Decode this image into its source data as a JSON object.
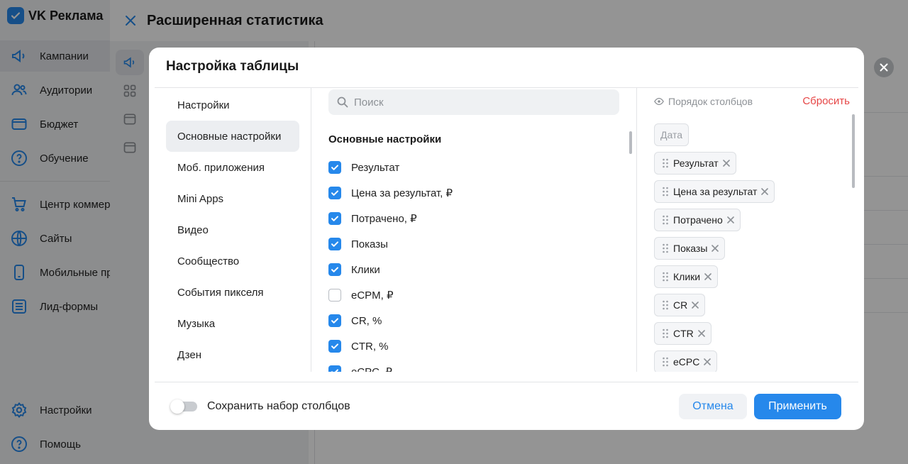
{
  "app": {
    "logo_text": "VK Реклама"
  },
  "sidebar": {
    "items": [
      {
        "label": "Кампании",
        "icon": "megaphone-icon",
        "active": true
      },
      {
        "label": "Аудитории",
        "icon": "users-icon"
      },
      {
        "label": "Бюджет",
        "icon": "wallet-icon"
      },
      {
        "label": "Обучение",
        "icon": "help-circle-icon"
      },
      {
        "label": "Центр коммер",
        "icon": "cart-icon"
      },
      {
        "label": "Сайты",
        "icon": "globe-icon"
      },
      {
        "label": "Мобильные пр",
        "icon": "phone-icon"
      },
      {
        "label": "Лид-формы",
        "icon": "list-icon"
      },
      {
        "label": "Настройки",
        "icon": "gear-icon"
      },
      {
        "label": "Помощь",
        "icon": "help-circle-icon"
      }
    ]
  },
  "page": {
    "title": "Расширенная статистика"
  },
  "modal": {
    "title": "Настройка таблицы",
    "categories": [
      "Настройки",
      "Основные настройки",
      "Моб. приложения",
      "Mini Apps",
      "Видео",
      "Сообщество",
      "События пикселя",
      "Музыка",
      "Дзен"
    ],
    "active_category": "Основные настройки",
    "search": {
      "placeholder": "Поиск",
      "value": ""
    },
    "section_title": "Основные настройки",
    "options": [
      {
        "label": "Результат",
        "checked": true
      },
      {
        "label": "Цена за результат, ₽",
        "checked": true
      },
      {
        "label": "Потрачено, ₽",
        "checked": true
      },
      {
        "label": "Показы",
        "checked": true
      },
      {
        "label": "Клики",
        "checked": true
      },
      {
        "label": "eCPM, ₽",
        "checked": false
      },
      {
        "label": "CR, %",
        "checked": true
      },
      {
        "label": "CTR, %",
        "checked": true
      },
      {
        "label": "eCPC, ₽",
        "checked": true
      }
    ],
    "column_order": {
      "title": "Порядок столбцов",
      "reset_label": "Сбросить",
      "fixed_column": "Дата",
      "columns": [
        "Результат",
        "Цена за результат",
        "Потрачено",
        "Показы",
        "Клики",
        "CR",
        "CTR",
        "eCPC"
      ]
    },
    "footer": {
      "toggle_label": "Сохранить набор столбцов",
      "toggle_on": false,
      "cancel_label": "Отмена",
      "apply_label": "Применить"
    }
  },
  "colors": {
    "accent": "#2688eb",
    "danger": "#e64646",
    "overlay": "rgba(0,0,0,0.42)"
  }
}
